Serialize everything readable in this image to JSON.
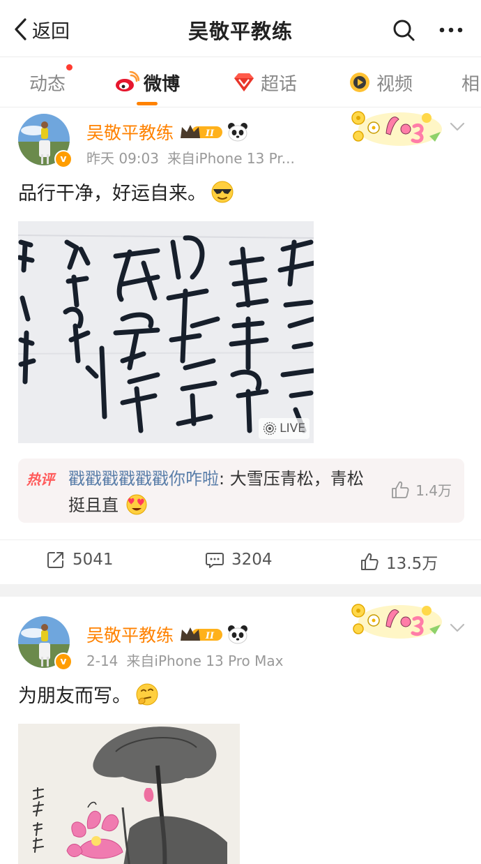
{
  "header": {
    "back_label": "返回",
    "title": "吴敬平教练"
  },
  "tabs": [
    {
      "label": "动态",
      "icon": "none",
      "has_dot": true,
      "active": false
    },
    {
      "label": "微博",
      "icon": "weibo-icon",
      "active": true
    },
    {
      "label": "超话",
      "icon": "supertopic-gem-icon",
      "active": false
    },
    {
      "label": "视频",
      "icon": "video-icon",
      "active": false
    },
    {
      "label": "相",
      "icon": "none",
      "active": false
    }
  ],
  "colors": {
    "accent": "#ff8200",
    "username": "#ff8200",
    "commenter": "#5a7ea9",
    "hot_tag": "#ff5a5a",
    "notification_dot": "#ff3b30"
  },
  "posts": [
    {
      "author": "吴敬平教练",
      "level_badge": "II",
      "time": "昨天 09:03",
      "source": "来自iPhone 13 Pr...",
      "text": "品行干净，好运自来。",
      "emoji": "sunglasses-emoji",
      "image": {
        "type": "calligraphy",
        "live_label": "LIVE"
      },
      "hot_comment": {
        "tag": "热评",
        "user": "戳戳戳戳戳戳你咋啦",
        "separator": ": ",
        "text": "大雪压青松，青松挺且直",
        "emoji": "heart-eyes-emoji",
        "likes": "1.4万"
      },
      "stats": {
        "reposts": "5041",
        "comments": "3204",
        "likes": "13.5万"
      }
    },
    {
      "author": "吴敬平教练",
      "level_badge": "II",
      "time": "2-14",
      "source": "来自iPhone 13 Pro Max",
      "text": "为朋友而写。",
      "emoji": "thinking-emoji",
      "image": {
        "type": "lotus-painting"
      }
    }
  ]
}
